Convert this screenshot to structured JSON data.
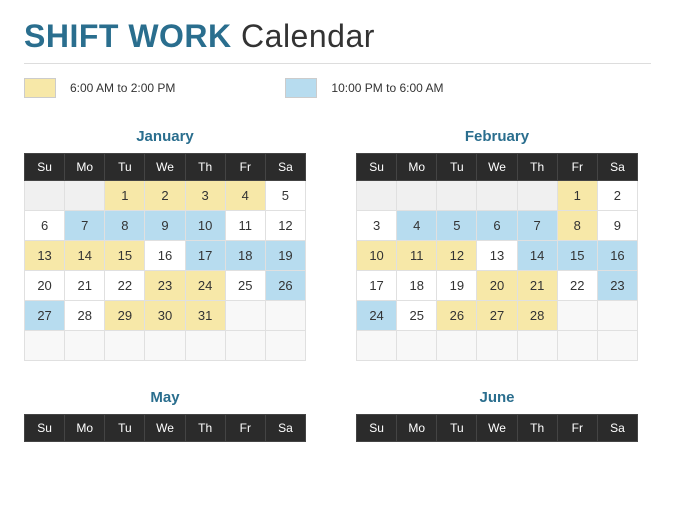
{
  "title": {
    "strong": "SHIFT WORK",
    "rest": "Calendar"
  },
  "legend": [
    {
      "color": "yellow",
      "label": "6:00 AM to 2:00 PM"
    },
    {
      "color": "blue",
      "label": "10:00 PM to 6:00 AM"
    }
  ],
  "dayHeaders": [
    "Su",
    "Mo",
    "Tu",
    "We",
    "Th",
    "Fr",
    "Sa"
  ],
  "months": [
    {
      "name": "January",
      "weeks": [
        [
          {
            "d": "",
            "c": "e"
          },
          {
            "d": "",
            "c": "e"
          },
          {
            "d": "1",
            "c": "y"
          },
          {
            "d": "2",
            "c": "y"
          },
          {
            "d": "3",
            "c": "y"
          },
          {
            "d": "4",
            "c": "y"
          },
          {
            "d": "5",
            "c": "w"
          }
        ],
        [
          {
            "d": "6",
            "c": "w"
          },
          {
            "d": "7",
            "c": "b"
          },
          {
            "d": "8",
            "c": "b"
          },
          {
            "d": "9",
            "c": "b"
          },
          {
            "d": "10",
            "c": "b"
          },
          {
            "d": "11",
            "c": "w"
          },
          {
            "d": "12",
            "c": "w"
          }
        ],
        [
          {
            "d": "13",
            "c": "y"
          },
          {
            "d": "14",
            "c": "y"
          },
          {
            "d": "15",
            "c": "y"
          },
          {
            "d": "16",
            "c": "w"
          },
          {
            "d": "17",
            "c": "b"
          },
          {
            "d": "18",
            "c": "b"
          },
          {
            "d": "19",
            "c": "b"
          }
        ],
        [
          {
            "d": "20",
            "c": "w"
          },
          {
            "d": "21",
            "c": "w"
          },
          {
            "d": "22",
            "c": "w"
          },
          {
            "d": "23",
            "c": "y"
          },
          {
            "d": "24",
            "c": "y"
          },
          {
            "d": "25",
            "c": "w"
          },
          {
            "d": "26",
            "c": "b"
          }
        ],
        [
          {
            "d": "27",
            "c": "b"
          },
          {
            "d": "28",
            "c": "w"
          },
          {
            "d": "29",
            "c": "y"
          },
          {
            "d": "30",
            "c": "y"
          },
          {
            "d": "31",
            "c": "y"
          },
          {
            "d": "",
            "c": "e"
          },
          {
            "d": "",
            "c": "e"
          }
        ],
        [
          {
            "d": "",
            "c": "e"
          },
          {
            "d": "",
            "c": "e"
          },
          {
            "d": "",
            "c": "e"
          },
          {
            "d": "",
            "c": "e"
          },
          {
            "d": "",
            "c": "e"
          },
          {
            "d": "",
            "c": "e"
          },
          {
            "d": "",
            "c": "e"
          }
        ]
      ]
    },
    {
      "name": "February",
      "weeks": [
        [
          {
            "d": "",
            "c": "e"
          },
          {
            "d": "",
            "c": "e"
          },
          {
            "d": "",
            "c": "e"
          },
          {
            "d": "",
            "c": "e"
          },
          {
            "d": "",
            "c": "e"
          },
          {
            "d": "1",
            "c": "y"
          },
          {
            "d": "2",
            "c": "w"
          }
        ],
        [
          {
            "d": "3",
            "c": "w"
          },
          {
            "d": "4",
            "c": "b"
          },
          {
            "d": "5",
            "c": "b"
          },
          {
            "d": "6",
            "c": "b"
          },
          {
            "d": "7",
            "c": "b"
          },
          {
            "d": "8",
            "c": "y"
          },
          {
            "d": "9",
            "c": "w"
          }
        ],
        [
          {
            "d": "10",
            "c": "y"
          },
          {
            "d": "11",
            "c": "y"
          },
          {
            "d": "12",
            "c": "y"
          },
          {
            "d": "13",
            "c": "w"
          },
          {
            "d": "14",
            "c": "b"
          },
          {
            "d": "15",
            "c": "b"
          },
          {
            "d": "16",
            "c": "b"
          }
        ],
        [
          {
            "d": "17",
            "c": "w"
          },
          {
            "d": "18",
            "c": "w"
          },
          {
            "d": "19",
            "c": "w"
          },
          {
            "d": "20",
            "c": "y"
          },
          {
            "d": "21",
            "c": "y"
          },
          {
            "d": "22",
            "c": "w"
          },
          {
            "d": "23",
            "c": "b"
          }
        ],
        [
          {
            "d": "24",
            "c": "b"
          },
          {
            "d": "25",
            "c": "w"
          },
          {
            "d": "26",
            "c": "y"
          },
          {
            "d": "27",
            "c": "y"
          },
          {
            "d": "28",
            "c": "y"
          },
          {
            "d": "",
            "c": "e"
          },
          {
            "d": "",
            "c": "e"
          }
        ],
        [
          {
            "d": "",
            "c": "e"
          },
          {
            "d": "",
            "c": "e"
          },
          {
            "d": "",
            "c": "e"
          },
          {
            "d": "",
            "c": "e"
          },
          {
            "d": "",
            "c": "e"
          },
          {
            "d": "",
            "c": "e"
          },
          {
            "d": "",
            "c": "e"
          }
        ]
      ]
    },
    {
      "name": "May",
      "weeks": []
    },
    {
      "name": "June",
      "weeks": []
    }
  ]
}
